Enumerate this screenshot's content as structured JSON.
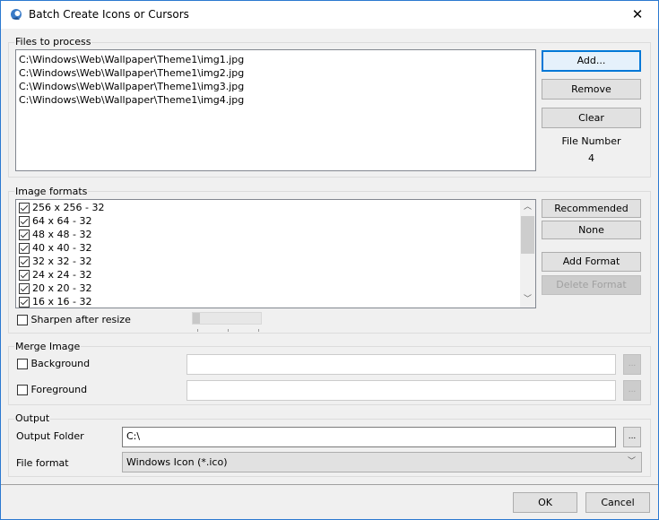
{
  "window": {
    "title": "Batch Create Icons or Cursors",
    "close": "✕",
    "accent": "#2b79d0"
  },
  "files": {
    "label": "Files to process",
    "items": [
      "C:\\Windows\\Web\\Wallpaper\\Theme1\\img1.jpg",
      "C:\\Windows\\Web\\Wallpaper\\Theme1\\img2.jpg",
      "C:\\Windows\\Web\\Wallpaper\\Theme1\\img3.jpg",
      "C:\\Windows\\Web\\Wallpaper\\Theme1\\img4.jpg"
    ],
    "add": "Add...",
    "remove": "Remove",
    "clear": "Clear",
    "file_number_label": "File Number",
    "file_number": "4"
  },
  "formats": {
    "label": "Image formats",
    "items": [
      {
        "label": "256 x 256 - 32",
        "checked": true
      },
      {
        "label": "64 x 64 - 32",
        "checked": true
      },
      {
        "label": "48 x 48 - 32",
        "checked": true
      },
      {
        "label": "40 x 40 - 32",
        "checked": true
      },
      {
        "label": "32 x 32 - 32",
        "checked": true
      },
      {
        "label": "24 x 24 - 32",
        "checked": true
      },
      {
        "label": "20 x 20 - 32",
        "checked": true
      },
      {
        "label": "16 x 16 - 32",
        "checked": true
      }
    ],
    "recommended": "Recommended",
    "none": "None",
    "add_format": "Add Format",
    "delete_format": "Delete Format",
    "sharpen": "Sharpen after resize",
    "sharpen_checked": false,
    "sharpen_level": 0
  },
  "merge": {
    "label": "Merge Image",
    "background": "Background",
    "foreground": "Foreground",
    "background_value": "",
    "foreground_value": "",
    "browse": "..."
  },
  "output": {
    "label": "Output",
    "folder_label": "Output Folder",
    "folder_value": "C:\\",
    "browse": "...",
    "format_label": "File format",
    "format_value": "Windows Icon (*.ico)"
  },
  "footer": {
    "ok": "OK",
    "cancel": "Cancel"
  }
}
